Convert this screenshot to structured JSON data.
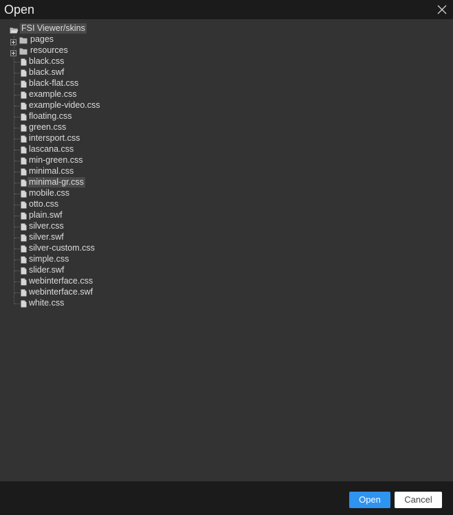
{
  "dialog": {
    "title": "Open",
    "close_icon": "close-icon"
  },
  "tree": {
    "root": {
      "label": "FSI Viewer/skins",
      "icon": "folder-open-icon"
    },
    "folders": [
      {
        "label": "pages",
        "icon": "folder-icon",
        "expander": "plus-icon"
      },
      {
        "label": "resources",
        "icon": "folder-icon",
        "expander": "plus-icon"
      }
    ],
    "files": [
      {
        "label": "black.css"
      },
      {
        "label": "black.swf"
      },
      {
        "label": "black-flat.css"
      },
      {
        "label": "example.css"
      },
      {
        "label": "example-video.css"
      },
      {
        "label": "floating.css"
      },
      {
        "label": "green.css"
      },
      {
        "label": "intersport.css"
      },
      {
        "label": "lascana.css"
      },
      {
        "label": "min-green.css"
      },
      {
        "label": "minimal.css"
      },
      {
        "label": "minimal-gr.css",
        "selected": true
      },
      {
        "label": "mobile.css"
      },
      {
        "label": "otto.css"
      },
      {
        "label": "plain.swf"
      },
      {
        "label": "silver.css"
      },
      {
        "label": "silver.swf"
      },
      {
        "label": "silver-custom.css"
      },
      {
        "label": "simple.css"
      },
      {
        "label": "slider.swf"
      },
      {
        "label": "webinterface.css"
      },
      {
        "label": "webinterface.swf"
      },
      {
        "label": "white.css"
      }
    ]
  },
  "footer": {
    "open_label": "Open",
    "cancel_label": "Cancel"
  },
  "colors": {
    "accent": "#2f93f0",
    "background": "#333333",
    "titlebar": "#1b1b1b",
    "selection": "#4a4a4a"
  }
}
